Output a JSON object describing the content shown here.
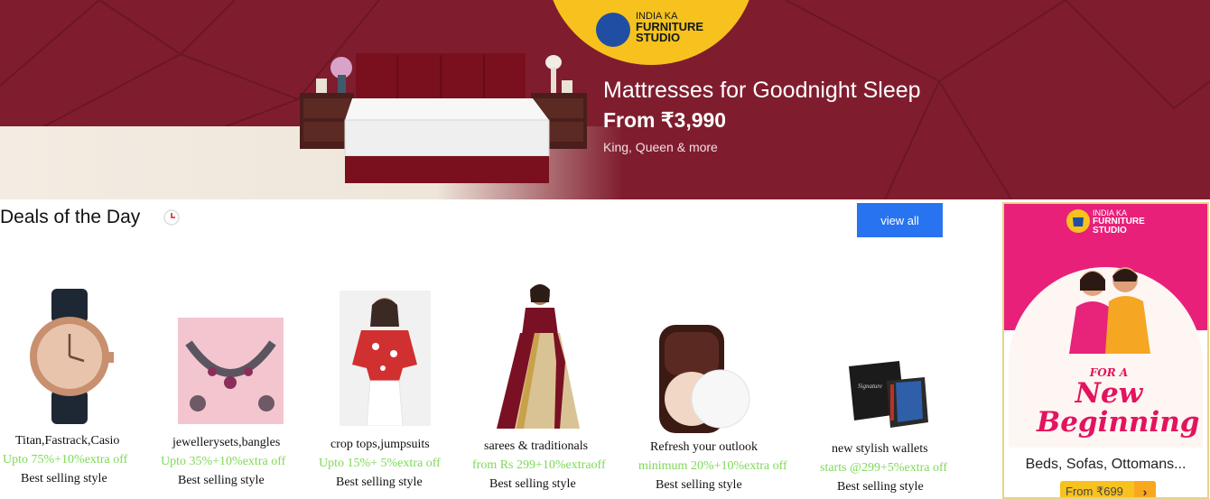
{
  "banner": {
    "logo_line1": "INDIA KA",
    "logo_line2": "FURNITURE",
    "logo_line3": "STUDIO",
    "headline": "Mattresses for Goodnight Sleep",
    "price": "From ₹3,990",
    "subtitle": "King, Queen & more"
  },
  "deals": {
    "title": "Deals of the Day",
    "view_all_label": "view all",
    "items": [
      {
        "name": "Titan,Fastrack,Casio",
        "offer": "Upto 75%+10%extra off",
        "tag": "Best selling style",
        "icon": "watch"
      },
      {
        "name": "jewellerysets,bangles",
        "offer": "Upto 35%+10%extra off",
        "tag": "Best selling style",
        "icon": "necklace"
      },
      {
        "name": "crop tops,jumpsuits",
        "offer": "Upto 15%+ 5%extra off",
        "tag": "Best selling style",
        "icon": "top"
      },
      {
        "name": "sarees & traditionals",
        "offer": "from Rs 299+10%extraoff",
        "tag": "Best selling style",
        "icon": "saree"
      },
      {
        "name": "Refresh your outlook",
        "offer": "minimum 20%+10%extra off",
        "tag": "Best selling style",
        "icon": "compact"
      },
      {
        "name": "new stylish wallets",
        "offer": "starts @299+5%extra off",
        "tag": "Best selling style",
        "icon": "wallet"
      }
    ]
  },
  "ad": {
    "logo_line1": "INDIA KA",
    "logo_line2": "FURNITURE",
    "logo_line3": "STUDIO",
    "tagline_small": "FOR A",
    "tagline_line1": "New",
    "tagline_line2": "Beginning",
    "categories": "Beds, Sofas, Ottomans...",
    "cta_label": "From ₹699",
    "cta_arrow": "›"
  },
  "colors": {
    "banner_bg": "#7f1d2e",
    "logo_yellow": "#f7c21e",
    "view_all_bg": "#2874f0",
    "offer_green": "#7ed957",
    "ad_pink": "#e8207a"
  }
}
